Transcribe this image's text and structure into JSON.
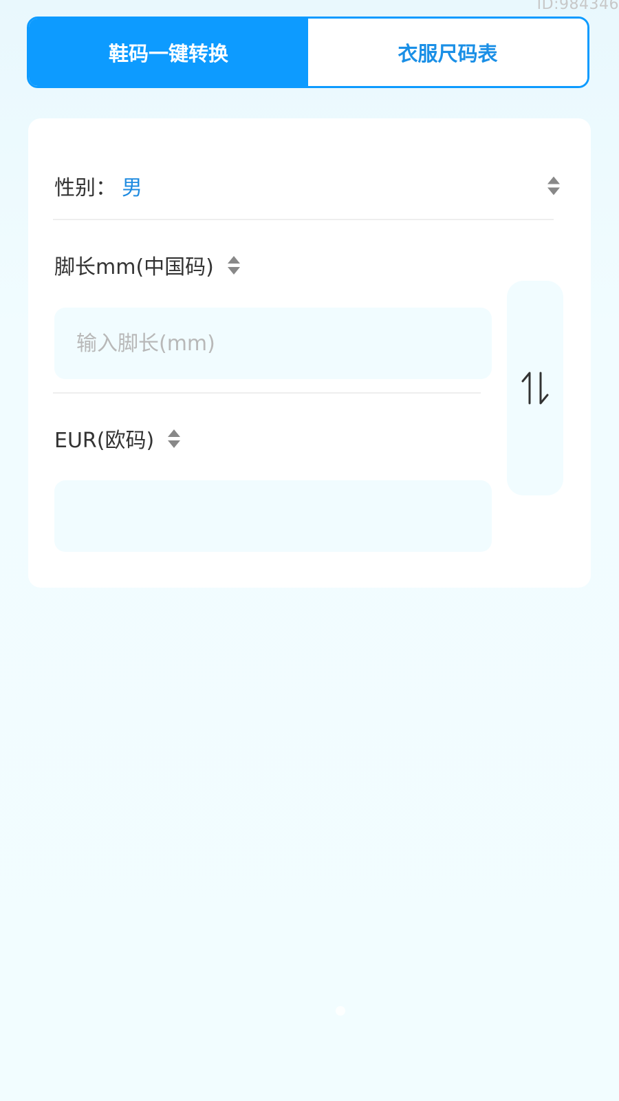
{
  "watermark": "ID:984346",
  "tabs": [
    {
      "label": "鞋码一键转换",
      "active": true
    },
    {
      "label": "衣服尺码表",
      "active": false
    }
  ],
  "gender": {
    "label": "性别：",
    "value": "男"
  },
  "source_field": {
    "label": "脚长mm(中国码)",
    "placeholder": "输入脚长(mm)",
    "value": ""
  },
  "target_field": {
    "label": "EUR(欧码)",
    "placeholder": "",
    "value": ""
  },
  "icons": {
    "gender_select": "sort-updown-icon",
    "source_select": "sort-updown-icon",
    "target_select": "sort-updown-icon",
    "swap": "swap-vertical-arrows-icon"
  },
  "colors": {
    "accent": "#0d9bff",
    "gender_value": "#1f8be0",
    "input_bg": "#f1fcff",
    "page_bg": "#f2fdff"
  }
}
